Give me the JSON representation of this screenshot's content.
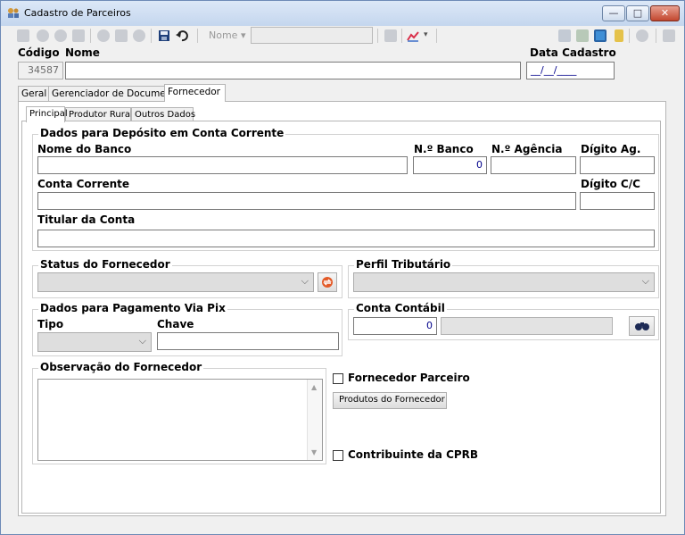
{
  "window": {
    "title": "Cadastro de Parceiros",
    "minimize": "—",
    "maximize": "□",
    "close": "✕"
  },
  "toolbar": {
    "nome_label": "Nome ▾",
    "nome_value": ""
  },
  "header": {
    "codigo_label": "Código",
    "nome_label": "Nome",
    "data_label": "Data Cadastro",
    "codigo_value": "34587",
    "nome_value": "",
    "data_value": "__/__/____"
  },
  "tabs": [
    "Geral",
    "Gerenciador de Documentos",
    "Fornecedor"
  ],
  "subtabs": [
    "Principal",
    "Produtor Rural",
    "Outros Dados"
  ],
  "deposito": {
    "group_label": "Dados para Depósito em Conta Corrente",
    "nome_banco_label": "Nome do Banco",
    "nro_banco_label": "N.º Banco",
    "nro_agencia_label": "N.º Agência",
    "digito_ag_label": "Dígito Ag.",
    "conta_label": "Conta Corrente",
    "digito_cc_label": "Dígito C/C",
    "titular_label": "Titular da Conta",
    "nro_banco_value": "0",
    "nome_banco_value": "",
    "agencia_value": "",
    "digito_ag_value": "",
    "conta_value": "",
    "digito_cc_value": "",
    "titular_value": ""
  },
  "status": {
    "group_label": "Status do Fornecedor",
    "value": ""
  },
  "perfil": {
    "group_label": "Perfil Tributário",
    "value": ""
  },
  "pix": {
    "group_label": "Dados para Pagamento Via Pix",
    "tipo_label": "Tipo",
    "chave_label": "Chave",
    "chave_value": ""
  },
  "contabil": {
    "group_label": "Conta Contábil",
    "value": "0",
    "descricao": ""
  },
  "observacao": {
    "group_label": "Observação do Fornecedor",
    "value": ""
  },
  "fornecedor_parceiro_label": "Fornecedor Parceiro",
  "produtos_button": "Produtos do Fornecedor",
  "cprb_label": "Contribuinte da CPRB"
}
